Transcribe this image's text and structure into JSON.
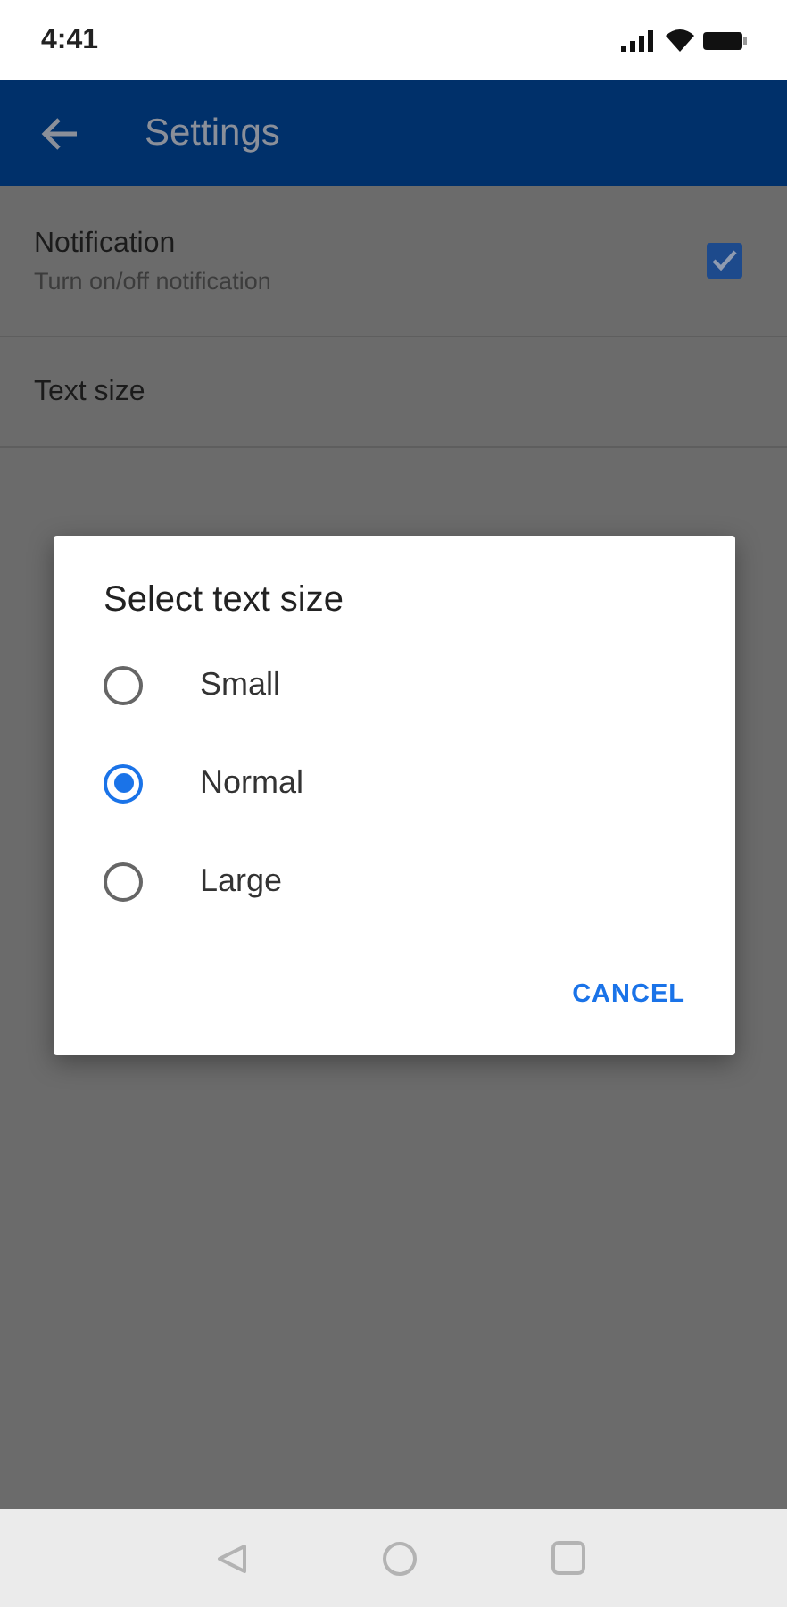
{
  "status_bar": {
    "time": "4:41"
  },
  "app_bar": {
    "title": "Settings"
  },
  "settings": [
    {
      "kind": "checkbox",
      "title": "Notification",
      "subtitle": "Turn on/off notification",
      "checked": true
    },
    {
      "kind": "plain",
      "title": "Text size"
    }
  ],
  "dialog": {
    "title": "Select text size",
    "options": [
      {
        "label": "Small",
        "selected": false
      },
      {
        "label": "Normal",
        "selected": true
      },
      {
        "label": "Large",
        "selected": false
      }
    ],
    "buttons": [
      "CANCEL"
    ]
  }
}
